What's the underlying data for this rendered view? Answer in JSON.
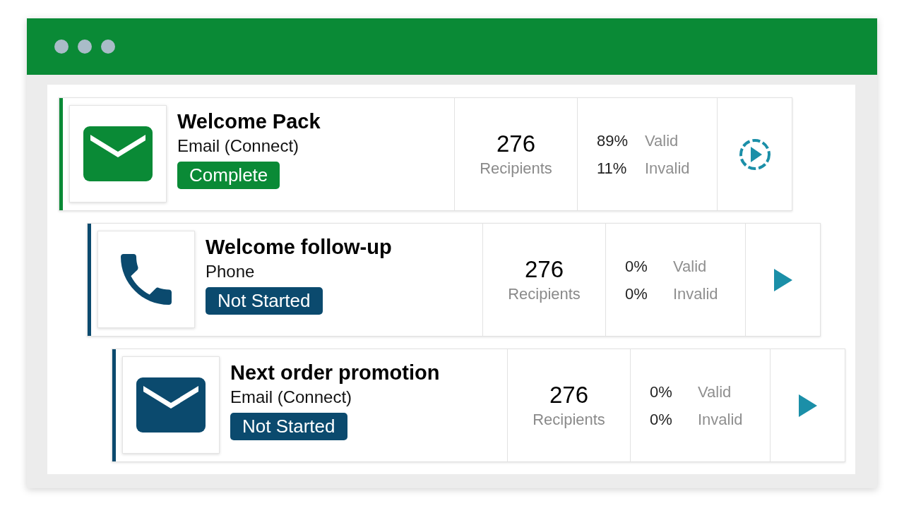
{
  "steps": [
    {
      "title": "Welcome Pack",
      "channel": {
        "kind": "email",
        "label": "Email (Connect)"
      },
      "status": {
        "kind": "complete",
        "label": "Complete"
      },
      "count": "276",
      "count_label": "Recipients",
      "valid_pct": "89%",
      "valid_label": "Valid",
      "invalid_pct": "11%",
      "invalid_label": "Invalid",
      "action": {
        "kind": "running"
      },
      "children": [
        {
          "title": "Welcome follow-up",
          "channel": {
            "kind": "phone",
            "label": "Phone"
          },
          "status": {
            "kind": "not_started",
            "label": "Not Started"
          },
          "count": "276",
          "count_label": "Recipients",
          "valid_pct": "0%",
          "valid_label": "Valid",
          "invalid_pct": "0%",
          "invalid_label": "Invalid",
          "action": {
            "kind": "play"
          },
          "children": [
            {
              "title": "Next order promotion",
              "channel": {
                "kind": "email",
                "label": "Email (Connect)"
              },
              "status": {
                "kind": "not_started",
                "label": "Not Started"
              },
              "count": "276",
              "count_label": "Recipients",
              "valid_pct": "0%",
              "valid_label": "Valid",
              "invalid_pct": "0%",
              "invalid_label": "Invalid",
              "action": {
                "kind": "play"
              }
            }
          ]
        }
      ]
    }
  ]
}
